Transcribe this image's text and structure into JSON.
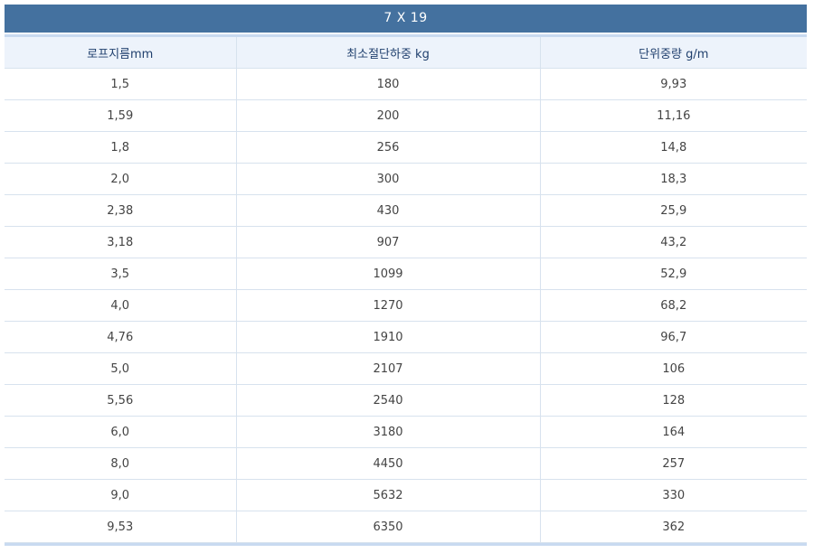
{
  "table": {
    "title": "7 X 19",
    "columns": [
      "로프지름mm",
      "최소절단하중 kg",
      "단위중량 g/m"
    ],
    "rows": [
      [
        "1,5",
        "180",
        "9,93"
      ],
      [
        "1,59",
        "200",
        "11,16"
      ],
      [
        "1,8",
        "256",
        "14,8"
      ],
      [
        "2,0",
        "300",
        "18,3"
      ],
      [
        "2,38",
        "430",
        "25,9"
      ],
      [
        "3,18",
        "907",
        "43,2"
      ],
      [
        "3,5",
        "1099",
        "52,9"
      ],
      [
        "4,0",
        "1270",
        "68,2"
      ],
      [
        "4,76",
        "1910",
        "96,7"
      ],
      [
        "5,0",
        "2107",
        "106"
      ],
      [
        "5,56",
        "2540",
        "128"
      ],
      [
        "6,0",
        "3180",
        "164"
      ],
      [
        "8,0",
        "4450",
        "257"
      ],
      [
        "9,0",
        "5632",
        "330"
      ],
      [
        "9,53",
        "6350",
        "362"
      ]
    ]
  },
  "colors": {
    "title_bg": "#44719f",
    "header_bg": "#edf3fb",
    "header_text": "#1f3f6d",
    "grid_line": "#d7e2ee",
    "cell_text": "#444444"
  }
}
